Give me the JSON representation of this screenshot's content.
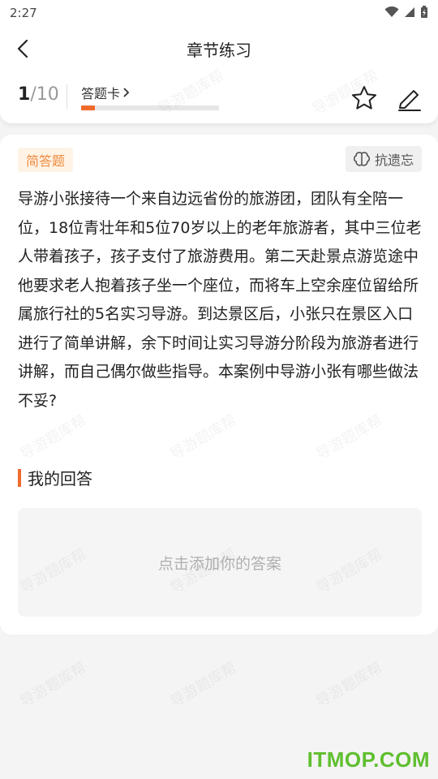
{
  "status": {
    "time": "2:27"
  },
  "nav": {
    "title": "章节练习"
  },
  "progress": {
    "current": "1",
    "total": "/10",
    "answer_card_label": "答题卡",
    "fraction": 0.1
  },
  "question": {
    "type": "简答题",
    "anti_forget_label": "抗遗忘",
    "text": "导游小张接待一个来自边远省份的旅游团，团队有全陪一位，18位青壮年和5位70岁以上的老年旅游者，其中三位老人带着孩子，孩子支付了旅游费用。第二天赴景点游览途中他要求老人抱着孩子坐一个座位，而将车上空余座位留给所属旅行社的5名实习导游。到达景区后，小张只在景区入口进行了简单讲解，余下时间让实习导游分阶段为旅游者进行讲解，而自己偶尔做些指导。本案例中导游小张有哪些做法不妥?"
  },
  "answer": {
    "heading": "我的回答",
    "placeholder": "点击添加你的答案"
  },
  "watermark_text": "导游题库帮",
  "site_mark": "ITMOP.COM",
  "colors": {
    "accent": "#f06a2c",
    "tag": "#f08a3c",
    "site": "#5fbf2f"
  }
}
